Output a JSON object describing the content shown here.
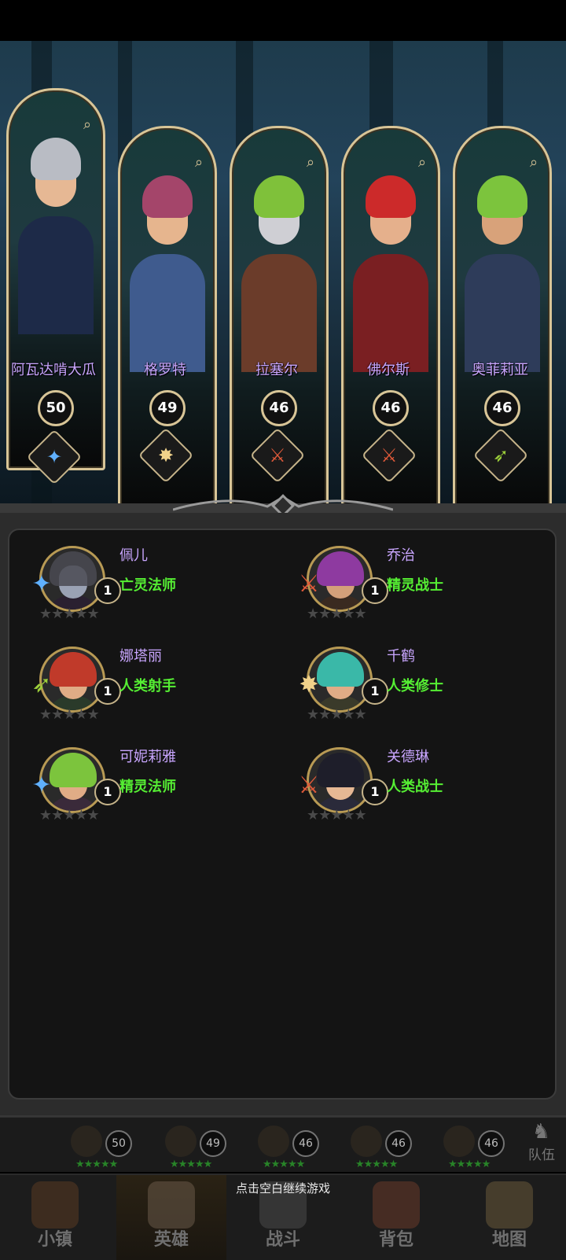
{
  "team": [
    {
      "name": "阿瓦达啃大瓜",
      "level": "50",
      "class_icon": "magic-staff-icon",
      "hair": "#b9bcc4",
      "skin": "#e6b894",
      "body": "#1d2a48",
      "accent": "#5fb0ff"
    },
    {
      "name": "格罗特",
      "level": "49",
      "class_icon": "holy-star-icon",
      "hair": "#a4456a",
      "skin": "#e6b58e",
      "body": "#3f5b8e",
      "accent": "#f1d28a"
    },
    {
      "name": "拉塞尔",
      "level": "46",
      "class_icon": "sword-icon",
      "hair": "#7fc13a",
      "skin": "#cfcfd4",
      "body": "#6b3c2a",
      "accent": "#e05a3a"
    },
    {
      "name": "佛尔斯",
      "level": "46",
      "class_icon": "sword-icon",
      "hair": "#cc2a2a",
      "skin": "#e5b08c",
      "body": "#7a1f22",
      "accent": "#e05a3a"
    },
    {
      "name": "奥菲莉亚",
      "level": "46",
      "class_icon": "bow-icon",
      "hair": "#7cc43d",
      "skin": "#d8a27a",
      "body": "#2e3c5a",
      "accent": "#9ccf3a"
    }
  ],
  "roster": [
    {
      "name": "佩儿",
      "level": "1",
      "class": "亡灵法师",
      "weapon_icon": "magic-staff-icon",
      "hair": "#4a4a52",
      "skin": "#9aa2b4",
      "body": "#2a2030"
    },
    {
      "name": "乔治",
      "level": "1",
      "class": "精灵战士",
      "weapon_icon": "sword-icon",
      "hair": "#8e3aa0",
      "skin": "#d4a07a",
      "body": "#3a2a20"
    },
    {
      "name": "娜塔丽",
      "level": "1",
      "class": "人类射手",
      "weapon_icon": "bow-icon",
      "hair": "#c03a2a",
      "skin": "#e0ac86",
      "body": "#2a3a2a"
    },
    {
      "name": "千鹤",
      "level": "1",
      "class": "人类修士",
      "weapon_icon": "holy-star-icon",
      "hair": "#3ab8a8",
      "skin": "#e0ac86",
      "body": "#3a3a2a"
    },
    {
      "name": "可妮莉雅",
      "level": "1",
      "class": "精灵法师",
      "weapon_icon": "magic-staff-icon",
      "hair": "#7cc43d",
      "skin": "#e0ac86",
      "body": "#3a2a3a"
    },
    {
      "name": "关德琳",
      "level": "1",
      "class": "人类战士",
      "weapon_icon": "sword-icon",
      "hair": "#1e1e2a",
      "skin": "#e6b894",
      "body": "#2a2a3a"
    }
  ],
  "strip": {
    "levels": [
      "50",
      "49",
      "46",
      "46",
      "46"
    ],
    "team_label": "队伍"
  },
  "hint": "点击空白继续游戏",
  "nav": {
    "town": "小镇",
    "heroes": "英雄",
    "battle": "战斗",
    "bag": "背包",
    "map": "地图"
  },
  "colors": {
    "name_purple": "#c9a6ff",
    "class_green": "#55ee33",
    "frame_gold": "#d8c597"
  }
}
